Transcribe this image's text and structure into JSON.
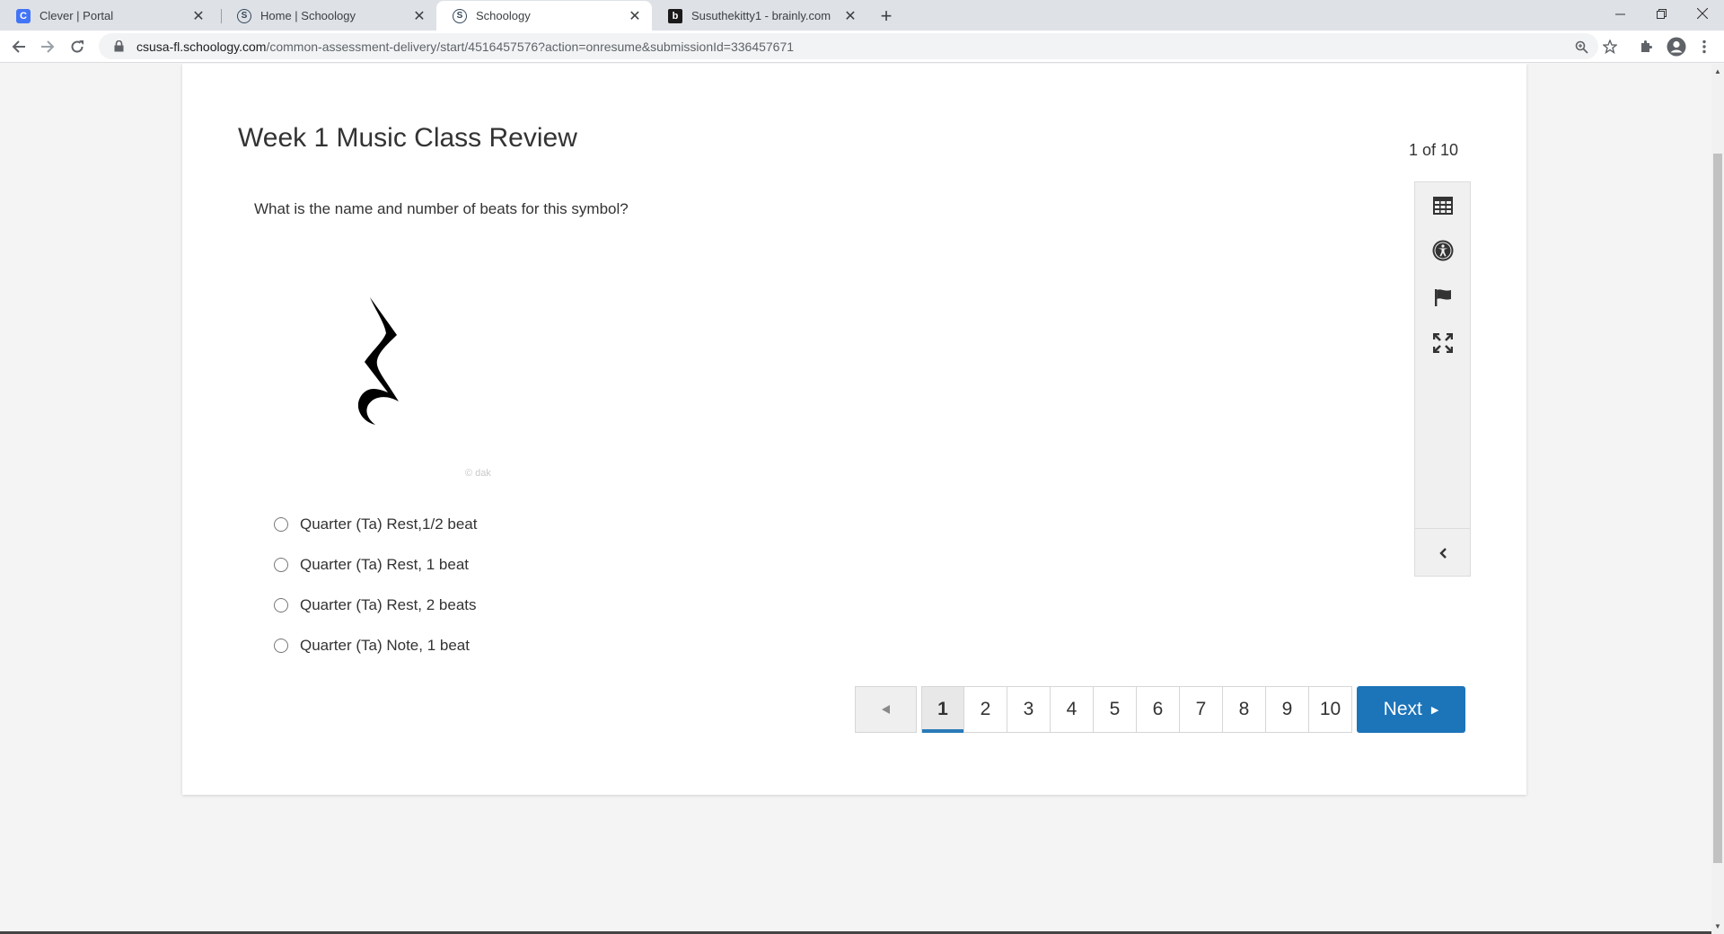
{
  "browser": {
    "tabs": [
      {
        "title": "Clever | Portal",
        "favicon": "clever",
        "favicon_glyph": "C",
        "active": false
      },
      {
        "title": "Home | Schoology",
        "favicon": "schoology",
        "favicon_glyph": "S",
        "active": false
      },
      {
        "title": "Schoology",
        "favicon": "schoology",
        "favicon_glyph": "S",
        "active": true
      },
      {
        "title": "Susuthekitty1 - brainly.com",
        "favicon": "brainly",
        "favicon_glyph": "b",
        "active": false
      }
    ],
    "url_domain": "csusa-fl.schoology.com",
    "url_path": "/common-assessment-delivery/start/4516457576?action=onresume&submissionId=336457671"
  },
  "assessment": {
    "title": "Week 1 Music Class Review",
    "counter": "1 of 10",
    "question": "What is the name and number of beats for this symbol?",
    "image_watermark": "© dak",
    "options": [
      {
        "label": "Quarter (Ta) Rest,1/2 beat"
      },
      {
        "label": "Quarter (Ta) Rest, 1 beat"
      },
      {
        "label": "Quarter (Ta) Rest, 2 beats"
      },
      {
        "label": "Quarter (Ta) Note, 1 beat"
      }
    ]
  },
  "side_tools": [
    "calculator-icon",
    "accessibility-icon",
    "flag-icon",
    "fullscreen-icon"
  ],
  "pager": {
    "pages": [
      "1",
      "2",
      "3",
      "4",
      "5",
      "6",
      "7",
      "8",
      "9",
      "10"
    ],
    "current": "1",
    "next_label": "Next"
  },
  "colors": {
    "accent": "#1c74b9",
    "current_underline": "#2a7ab8"
  }
}
